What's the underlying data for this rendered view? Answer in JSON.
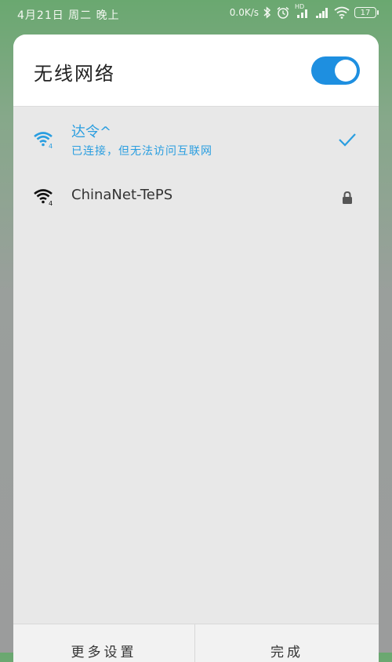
{
  "status_bar": {
    "datetime": "4月21日 周二 晚上",
    "net_speed": "0.0K/s",
    "signal_label": "HD",
    "battery": "17"
  },
  "dialog": {
    "title": "无线网络",
    "wifi_enabled": true,
    "accent_color": "#1e8fe0"
  },
  "networks": [
    {
      "name": "达令^",
      "status": "已连接，但无法访问互联网",
      "connected": true,
      "wifi_generation": "4",
      "icon": "wifi-connected-icon",
      "trailing_icon": "checkmark-icon"
    },
    {
      "name": "ChinaNet-TePS",
      "status": "",
      "connected": false,
      "wifi_generation": "4",
      "icon": "wifi-icon",
      "trailing_icon": "lock-icon"
    }
  ],
  "footer": {
    "more_settings_label": "更多设置",
    "done_label": "完成"
  }
}
